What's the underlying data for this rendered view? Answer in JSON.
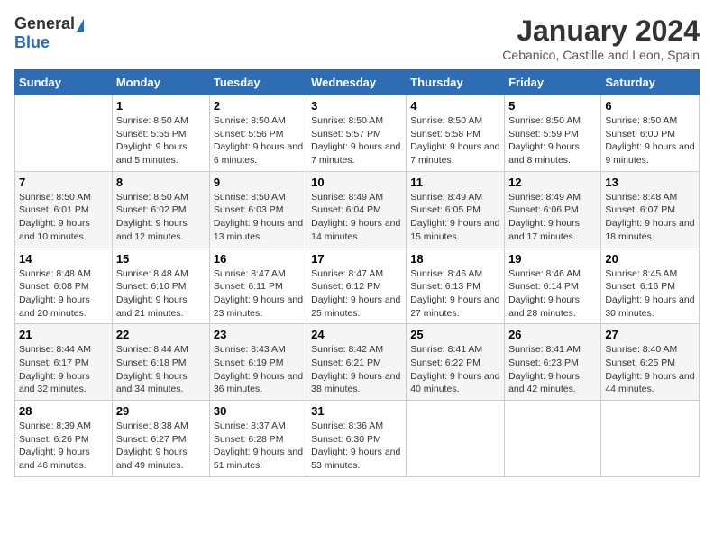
{
  "logo": {
    "general": "General",
    "blue": "Blue"
  },
  "title": "January 2024",
  "subtitle": "Cebanico, Castille and Leon, Spain",
  "days_of_week": [
    "Sunday",
    "Monday",
    "Tuesday",
    "Wednesday",
    "Thursday",
    "Friday",
    "Saturday"
  ],
  "weeks": [
    [
      {
        "day": "",
        "sunrise": "",
        "sunset": "",
        "daylight": ""
      },
      {
        "day": "1",
        "sunrise": "Sunrise: 8:50 AM",
        "sunset": "Sunset: 5:55 PM",
        "daylight": "Daylight: 9 hours and 5 minutes."
      },
      {
        "day": "2",
        "sunrise": "Sunrise: 8:50 AM",
        "sunset": "Sunset: 5:56 PM",
        "daylight": "Daylight: 9 hours and 6 minutes."
      },
      {
        "day": "3",
        "sunrise": "Sunrise: 8:50 AM",
        "sunset": "Sunset: 5:57 PM",
        "daylight": "Daylight: 9 hours and 7 minutes."
      },
      {
        "day": "4",
        "sunrise": "Sunrise: 8:50 AM",
        "sunset": "Sunset: 5:58 PM",
        "daylight": "Daylight: 9 hours and 7 minutes."
      },
      {
        "day": "5",
        "sunrise": "Sunrise: 8:50 AM",
        "sunset": "Sunset: 5:59 PM",
        "daylight": "Daylight: 9 hours and 8 minutes."
      },
      {
        "day": "6",
        "sunrise": "Sunrise: 8:50 AM",
        "sunset": "Sunset: 6:00 PM",
        "daylight": "Daylight: 9 hours and 9 minutes."
      }
    ],
    [
      {
        "day": "7",
        "sunrise": "Sunrise: 8:50 AM",
        "sunset": "Sunset: 6:01 PM",
        "daylight": "Daylight: 9 hours and 10 minutes."
      },
      {
        "day": "8",
        "sunrise": "Sunrise: 8:50 AM",
        "sunset": "Sunset: 6:02 PM",
        "daylight": "Daylight: 9 hours and 12 minutes."
      },
      {
        "day": "9",
        "sunrise": "Sunrise: 8:50 AM",
        "sunset": "Sunset: 6:03 PM",
        "daylight": "Daylight: 9 hours and 13 minutes."
      },
      {
        "day": "10",
        "sunrise": "Sunrise: 8:49 AM",
        "sunset": "Sunset: 6:04 PM",
        "daylight": "Daylight: 9 hours and 14 minutes."
      },
      {
        "day": "11",
        "sunrise": "Sunrise: 8:49 AM",
        "sunset": "Sunset: 6:05 PM",
        "daylight": "Daylight: 9 hours and 15 minutes."
      },
      {
        "day": "12",
        "sunrise": "Sunrise: 8:49 AM",
        "sunset": "Sunset: 6:06 PM",
        "daylight": "Daylight: 9 hours and 17 minutes."
      },
      {
        "day": "13",
        "sunrise": "Sunrise: 8:48 AM",
        "sunset": "Sunset: 6:07 PM",
        "daylight": "Daylight: 9 hours and 18 minutes."
      }
    ],
    [
      {
        "day": "14",
        "sunrise": "Sunrise: 8:48 AM",
        "sunset": "Sunset: 6:08 PM",
        "daylight": "Daylight: 9 hours and 20 minutes."
      },
      {
        "day": "15",
        "sunrise": "Sunrise: 8:48 AM",
        "sunset": "Sunset: 6:10 PM",
        "daylight": "Daylight: 9 hours and 21 minutes."
      },
      {
        "day": "16",
        "sunrise": "Sunrise: 8:47 AM",
        "sunset": "Sunset: 6:11 PM",
        "daylight": "Daylight: 9 hours and 23 minutes."
      },
      {
        "day": "17",
        "sunrise": "Sunrise: 8:47 AM",
        "sunset": "Sunset: 6:12 PM",
        "daylight": "Daylight: 9 hours and 25 minutes."
      },
      {
        "day": "18",
        "sunrise": "Sunrise: 8:46 AM",
        "sunset": "Sunset: 6:13 PM",
        "daylight": "Daylight: 9 hours and 27 minutes."
      },
      {
        "day": "19",
        "sunrise": "Sunrise: 8:46 AM",
        "sunset": "Sunset: 6:14 PM",
        "daylight": "Daylight: 9 hours and 28 minutes."
      },
      {
        "day": "20",
        "sunrise": "Sunrise: 8:45 AM",
        "sunset": "Sunset: 6:16 PM",
        "daylight": "Daylight: 9 hours and 30 minutes."
      }
    ],
    [
      {
        "day": "21",
        "sunrise": "Sunrise: 8:44 AM",
        "sunset": "Sunset: 6:17 PM",
        "daylight": "Daylight: 9 hours and 32 minutes."
      },
      {
        "day": "22",
        "sunrise": "Sunrise: 8:44 AM",
        "sunset": "Sunset: 6:18 PM",
        "daylight": "Daylight: 9 hours and 34 minutes."
      },
      {
        "day": "23",
        "sunrise": "Sunrise: 8:43 AM",
        "sunset": "Sunset: 6:19 PM",
        "daylight": "Daylight: 9 hours and 36 minutes."
      },
      {
        "day": "24",
        "sunrise": "Sunrise: 8:42 AM",
        "sunset": "Sunset: 6:21 PM",
        "daylight": "Daylight: 9 hours and 38 minutes."
      },
      {
        "day": "25",
        "sunrise": "Sunrise: 8:41 AM",
        "sunset": "Sunset: 6:22 PM",
        "daylight": "Daylight: 9 hours and 40 minutes."
      },
      {
        "day": "26",
        "sunrise": "Sunrise: 8:41 AM",
        "sunset": "Sunset: 6:23 PM",
        "daylight": "Daylight: 9 hours and 42 minutes."
      },
      {
        "day": "27",
        "sunrise": "Sunrise: 8:40 AM",
        "sunset": "Sunset: 6:25 PM",
        "daylight": "Daylight: 9 hours and 44 minutes."
      }
    ],
    [
      {
        "day": "28",
        "sunrise": "Sunrise: 8:39 AM",
        "sunset": "Sunset: 6:26 PM",
        "daylight": "Daylight: 9 hours and 46 minutes."
      },
      {
        "day": "29",
        "sunrise": "Sunrise: 8:38 AM",
        "sunset": "Sunset: 6:27 PM",
        "daylight": "Daylight: 9 hours and 49 minutes."
      },
      {
        "day": "30",
        "sunrise": "Sunrise: 8:37 AM",
        "sunset": "Sunset: 6:28 PM",
        "daylight": "Daylight: 9 hours and 51 minutes."
      },
      {
        "day": "31",
        "sunrise": "Sunrise: 8:36 AM",
        "sunset": "Sunset: 6:30 PM",
        "daylight": "Daylight: 9 hours and 53 minutes."
      },
      {
        "day": "",
        "sunrise": "",
        "sunset": "",
        "daylight": ""
      },
      {
        "day": "",
        "sunrise": "",
        "sunset": "",
        "daylight": ""
      },
      {
        "day": "",
        "sunrise": "",
        "sunset": "",
        "daylight": ""
      }
    ]
  ]
}
